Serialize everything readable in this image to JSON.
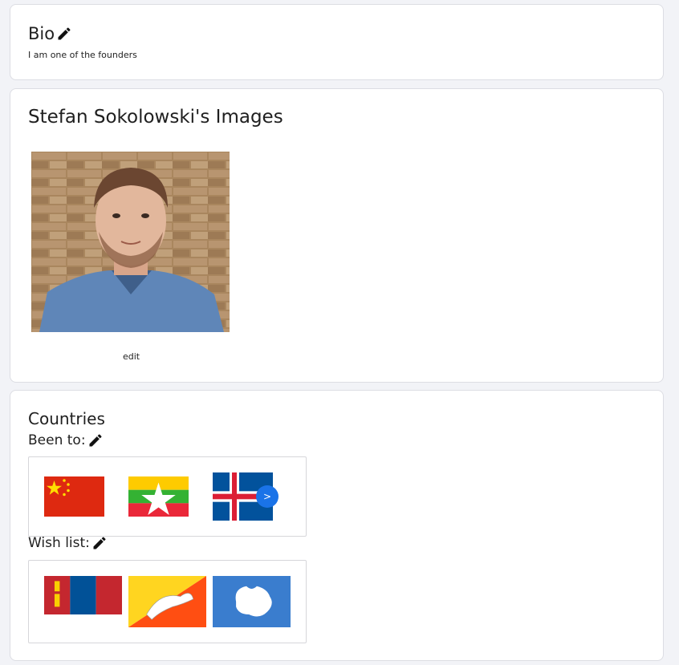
{
  "bio": {
    "title": "Bio",
    "text": "I am one of the founders"
  },
  "images": {
    "title": "Stefan Sokolowski's Images",
    "edit_label": "edit"
  },
  "countries": {
    "title": "Countries",
    "been_to_label": "Been to:",
    "wish_list_label": "Wish list:",
    "been_to": [
      "China",
      "Myanmar",
      "Iceland"
    ],
    "wish_list": [
      "Mongolia",
      "Bhutan",
      "Antarctica"
    ],
    "next_label": ">"
  },
  "colors": {
    "accent": "#1a73e8"
  },
  "icons": {
    "edit": "pencil-icon"
  }
}
